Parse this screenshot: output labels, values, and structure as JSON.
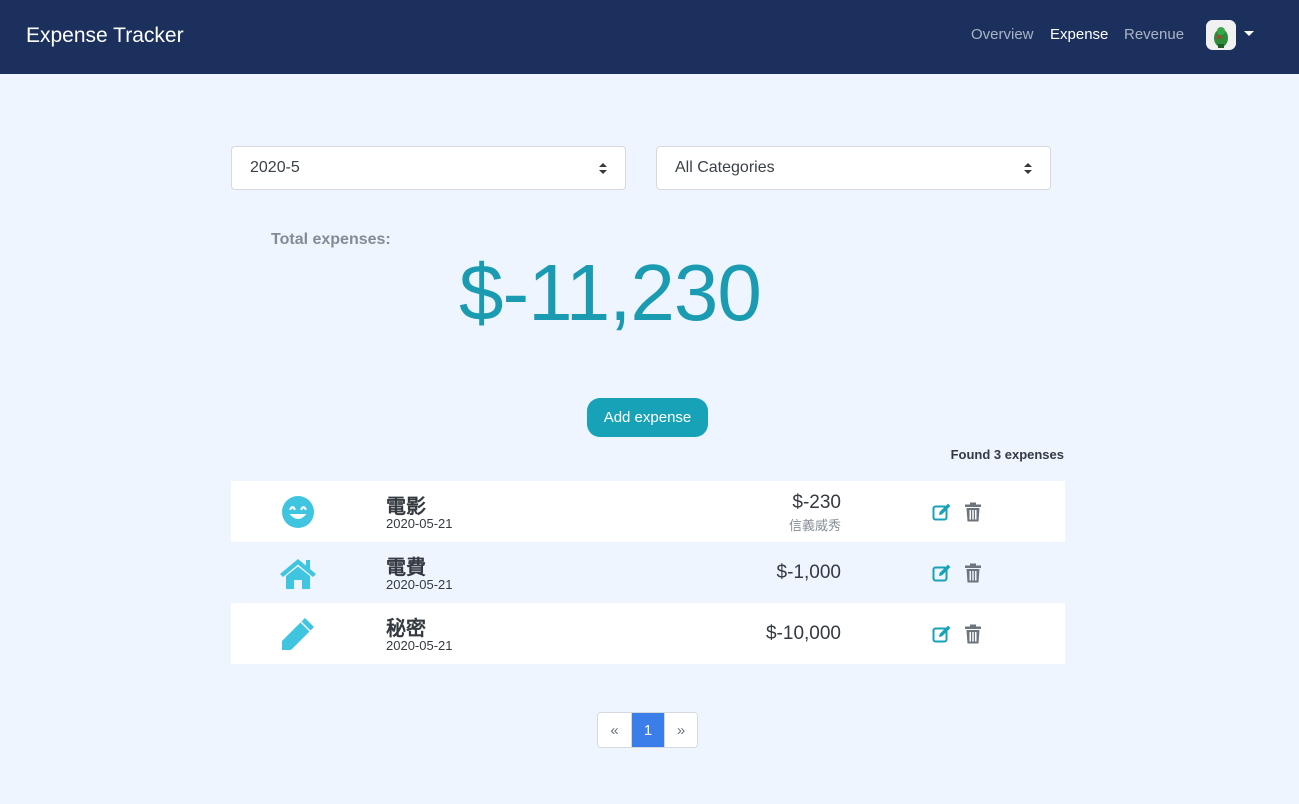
{
  "navbar": {
    "brand": "Expense Tracker",
    "links": [
      {
        "label": "Overview",
        "active": false
      },
      {
        "label": "Expense",
        "active": true
      },
      {
        "label": "Revenue",
        "active": false
      }
    ],
    "avatar_icon": "avatar-icon",
    "bg_color": "#1b305c"
  },
  "filters": {
    "month": "2020-5",
    "category": "All Categories"
  },
  "summary": {
    "label": "Total expenses:",
    "amount": "$-11,230"
  },
  "add_button": "Add expense",
  "found_text": "Found 3 expenses",
  "expenses": [
    {
      "icon": "smile-icon",
      "name": "電影",
      "date": "2020-05-21",
      "amount": "$-230",
      "merchant": "信義威秀"
    },
    {
      "icon": "home-icon",
      "name": "電費",
      "date": "2020-05-21",
      "amount": "$-1,000",
      "merchant": ""
    },
    {
      "icon": "pencil-icon",
      "name": "秘密",
      "date": "2020-05-21",
      "amount": "$-10,000",
      "merchant": ""
    }
  ],
  "pagination": {
    "prev": "«",
    "current": "1",
    "next": "»"
  },
  "colors": {
    "accent": "#17a2b8",
    "icon": "#3fc5df",
    "page_active": "#3b7de9",
    "background": "#eef5ff"
  }
}
